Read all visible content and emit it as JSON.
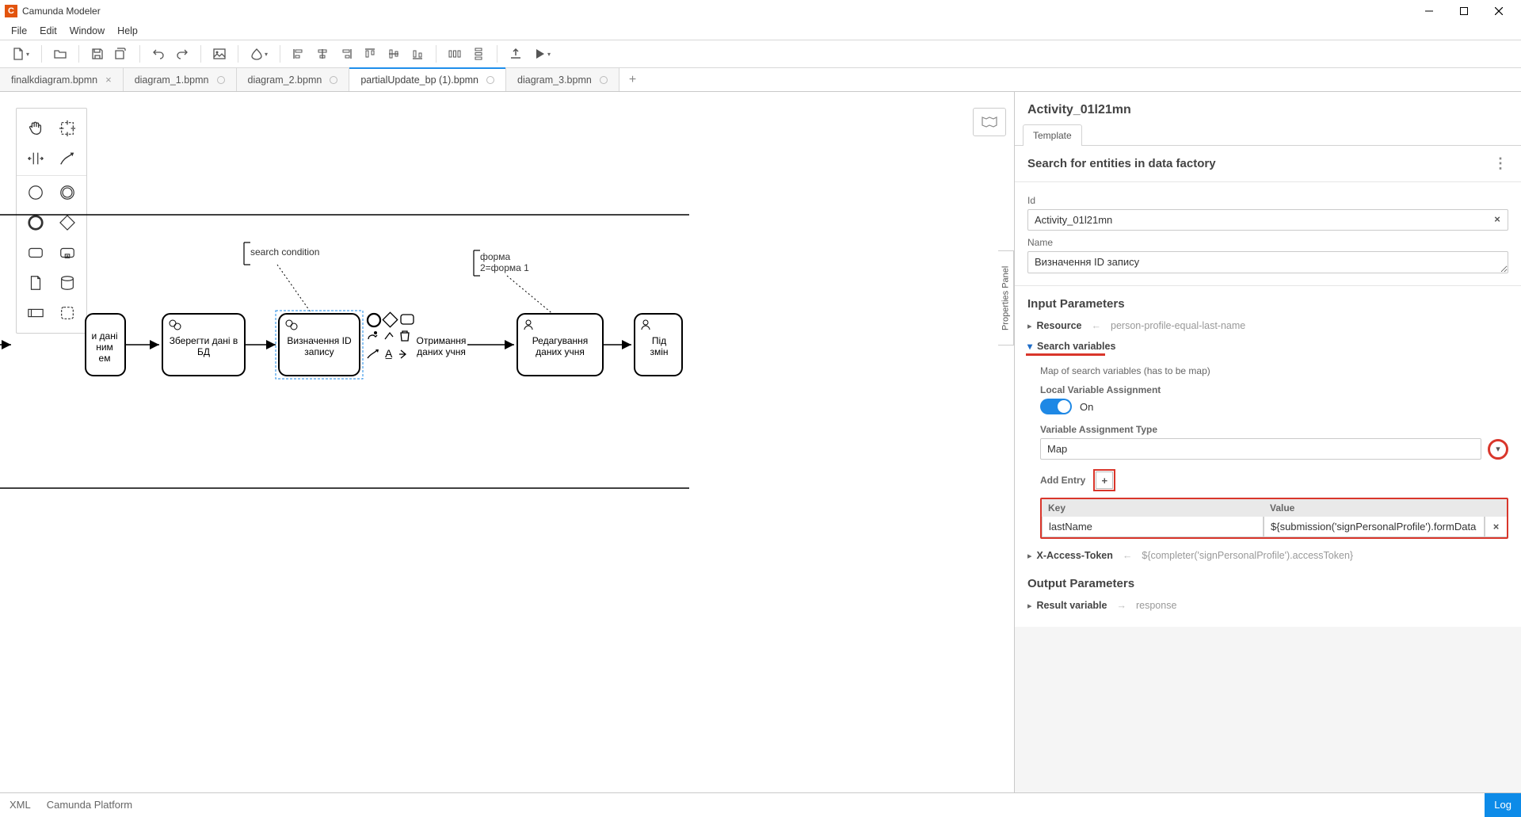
{
  "app": {
    "title": "Camunda Modeler"
  },
  "menu": {
    "file": "File",
    "edit": "Edit",
    "window": "Window",
    "help": "Help"
  },
  "tabs": {
    "t0": "finalkdiagram.bpmn",
    "t1": "diagram_1.bpmn",
    "t2": "diagram_2.bpmn",
    "t3": "partialUpdate_bp (1).bpmn",
    "t4": "diagram_3.bpmn"
  },
  "canvas": {
    "ann_search": "search condition",
    "ann_form": "форма\n2=форма 1",
    "task_prev_l1": "и дані",
    "task_prev_l2": "ним",
    "task_prev_l3": "ем",
    "task_save_l1": "Зберегти дані в",
    "task_save_l2": "БД",
    "task_defid_l1": "Визначення ID",
    "task_defid_l2": "запису",
    "task_get_l1": "Отримання",
    "task_get_l2": "даних учня",
    "task_edit_l1": "Редагування",
    "task_edit_l2": "даних учня",
    "task_next_l1": "Під",
    "task_next_l2": "змін",
    "props_toggle": "Properties Panel"
  },
  "props": {
    "title": "Activity_01l21mn",
    "tab_template": "Template",
    "section_search": "Search for entities in data factory",
    "id_label": "Id",
    "id_value": "Activity_01l21mn",
    "name_label": "Name",
    "name_value": "Визначення ID запису",
    "input_params": "Input Parameters",
    "resource_label": "Resource",
    "resource_val": "person-profile-equal-last-name",
    "searchvars_label": "Search variables",
    "searchvars_desc": "Map of search variables (has to be map)",
    "lva_label": "Local Variable Assignment",
    "lva_on": "On",
    "vat_label": "Variable Assignment Type",
    "vat_value": "Map",
    "add_entry": "Add Entry",
    "key_h": "Key",
    "val_h": "Value",
    "entry_key": "lastName",
    "entry_val": "${submission('signPersonalProfile').formData",
    "xat_label": "X-Access-Token",
    "xat_val": "${completer('signPersonalProfile').accessToken}",
    "output_params": "Output Parameters",
    "result_label": "Result variable",
    "result_val": "response"
  },
  "status": {
    "xml": "XML",
    "platform": "Camunda Platform",
    "log": "Log"
  }
}
